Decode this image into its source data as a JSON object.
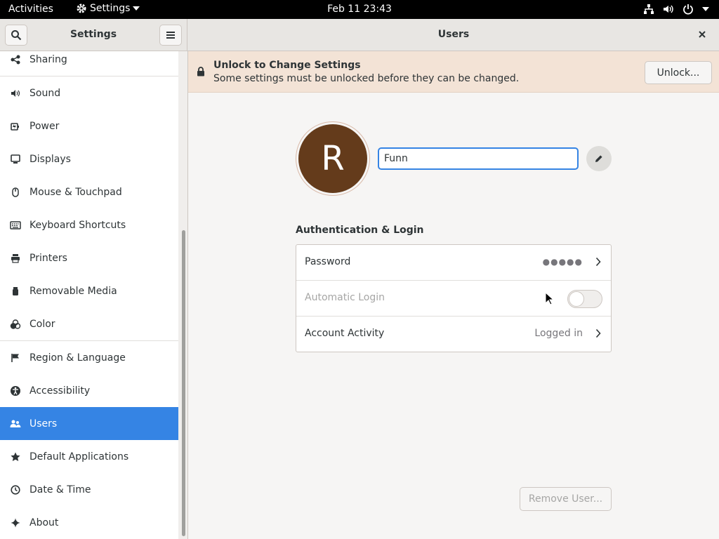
{
  "topbar": {
    "activities": "Activities",
    "app_menu": "Settings",
    "clock": "Feb 11  23:43",
    "icons": [
      "network-icon",
      "volume-icon",
      "power-icon"
    ]
  },
  "header": {
    "left_title": "Settings",
    "right_title": "Users"
  },
  "sidebar": {
    "items": [
      {
        "label": "Sharing",
        "icon": "share-icon"
      },
      {
        "label": "Sound",
        "icon": "speaker-icon"
      },
      {
        "label": "Power",
        "icon": "battery-icon"
      },
      {
        "label": "Displays",
        "icon": "display-icon"
      },
      {
        "label": "Mouse & Touchpad",
        "icon": "mouse-icon"
      },
      {
        "label": "Keyboard Shortcuts",
        "icon": "keyboard-icon"
      },
      {
        "label": "Printers",
        "icon": "printer-icon"
      },
      {
        "label": "Removable Media",
        "icon": "usb-drive-icon"
      },
      {
        "label": "Color",
        "icon": "color-icon"
      },
      {
        "label": "Region & Language",
        "icon": "flag-icon"
      },
      {
        "label": "Accessibility",
        "icon": "accessibility-icon"
      },
      {
        "label": "Users",
        "icon": "users-icon",
        "active": true
      },
      {
        "label": "Default Applications",
        "icon": "star-icon"
      },
      {
        "label": "Date & Time",
        "icon": "clock-icon"
      },
      {
        "label": "About",
        "icon": "sparkle-icon"
      }
    ]
  },
  "infobar": {
    "title": "Unlock to Change Settings",
    "subtitle": "Some settings must be unlocked before they can be changed.",
    "unlock_label": "Unlock..."
  },
  "user": {
    "avatar_letter": "R",
    "avatar_color": "#643b1b",
    "name_value": "Funn"
  },
  "auth": {
    "section_title": "Authentication & Login",
    "password_label": "Password",
    "password_value": "●●●●●",
    "autologin_label": "Automatic Login",
    "autologin_enabled": false,
    "activity_label": "Account Activity",
    "activity_value": "Logged in"
  },
  "remove_user_label": "Remove User...",
  "colors": {
    "accent": "#3584e4",
    "infobar_bg": "#f3e3d6"
  }
}
